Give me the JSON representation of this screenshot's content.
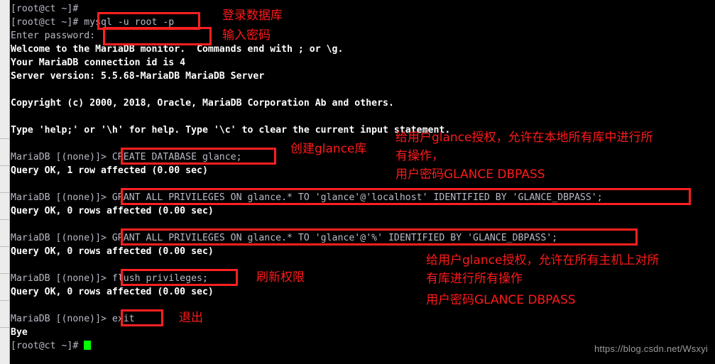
{
  "window": {
    "kind": "terminal",
    "background": "#000000",
    "text_color_dim": "#b9b9c6",
    "text_color_bold": "#ffffff",
    "annotation_color": "#ff1a1a",
    "cursor_color": "#00ff00",
    "gutter_color": "#ececec"
  },
  "terminal": {
    "lines": [
      {
        "id": "l01",
        "text": "[root@ct ~]#",
        "style": "dim"
      },
      {
        "id": "l02",
        "text": "[root@ct ~]# mysql -u root -p",
        "style": "dim"
      },
      {
        "id": "l03",
        "text": "Enter password:",
        "style": "dim"
      },
      {
        "id": "l04",
        "text": "Welcome to the MariaDB monitor.  Commands end with ; or \\g.",
        "style": "bold"
      },
      {
        "id": "l05",
        "text": "Your MariaDB connection id is 4",
        "style": "bold"
      },
      {
        "id": "l06",
        "text": "Server version: 5.5.68-MariaDB MariaDB Server",
        "style": "bold"
      },
      {
        "id": "l07",
        "text": "",
        "style": "bold"
      },
      {
        "id": "l08",
        "text": "Copyright (c) 2000, 2018, Oracle, MariaDB Corporation Ab and others.",
        "style": "bold"
      },
      {
        "id": "l09",
        "text": "",
        "style": "bold"
      },
      {
        "id": "l10",
        "text": "Type 'help;' or '\\h' for help. Type '\\c' to clear the current input statement.",
        "style": "bold"
      },
      {
        "id": "l11",
        "text": "",
        "style": "bold"
      },
      {
        "id": "l12",
        "text": "MariaDB [(none)]> CREATE DATABASE glance;",
        "style": "dim"
      },
      {
        "id": "l13",
        "text": "Query OK, 1 row affected (0.00 sec)",
        "style": "bold"
      },
      {
        "id": "l14",
        "text": "",
        "style": "bold"
      },
      {
        "id": "l15",
        "text": "MariaDB [(none)]> GRANT ALL PRIVILEGES ON glance.* TO 'glance'@'localhost' IDENTIFIED BY 'GLANCE_DBPASS';",
        "style": "dim"
      },
      {
        "id": "l16",
        "text": "Query OK, 0 rows affected (0.00 sec)",
        "style": "bold"
      },
      {
        "id": "l17",
        "text": "",
        "style": "bold"
      },
      {
        "id": "l18",
        "text": "MariaDB [(none)]> GRANT ALL PRIVILEGES ON glance.* TO 'glance'@'%' IDENTIFIED BY 'GLANCE_DBPASS';",
        "style": "dim"
      },
      {
        "id": "l19",
        "text": "Query OK, 0 rows affected (0.00 sec)",
        "style": "bold"
      },
      {
        "id": "l20",
        "text": "",
        "style": "bold"
      },
      {
        "id": "l21",
        "text": "MariaDB [(none)]> flush privileges;",
        "style": "dim"
      },
      {
        "id": "l22",
        "text": "Query OK, 0 rows affected (0.00 sec)",
        "style": "bold"
      },
      {
        "id": "l23",
        "text": "",
        "style": "bold"
      },
      {
        "id": "l24",
        "text": "MariaDB [(none)]> exit",
        "style": "dim"
      },
      {
        "id": "l25",
        "text": "Bye",
        "style": "bold"
      },
      {
        "id": "l26",
        "text": "[root@ct ~]# ",
        "style": "dim",
        "cursor": true
      }
    ]
  },
  "highlights": [
    {
      "id": "h-mysql-login",
      "target": "mysql -u root -p"
    },
    {
      "id": "h-password-entry",
      "target": ""
    },
    {
      "id": "h-create-db",
      "target": "CREATE DATABASE glance;"
    },
    {
      "id": "h-grant-localhost",
      "target": "GRANT ALL PRIVILEGES ON glance.* TO 'glance'@'localhost' IDENTIFIED BY 'GLANCE_DBPASS';"
    },
    {
      "id": "h-grant-any-host",
      "target": "GRANT ALL PRIVILEGES ON glance.* TO 'glance'@'%' IDENTIFIED BY 'GLANCE_DBPASS';"
    },
    {
      "id": "h-flush",
      "target": "flush privileges;"
    },
    {
      "id": "h-exit",
      "target": "exit"
    }
  ],
  "annotations": {
    "login_db": "登录数据库",
    "enter_password": "输入密码",
    "create_glance_db": "创建glance库",
    "grant_local_line1": "给用户glance授权，允许在本地所有库中进行所",
    "grant_local_line2": "有操作，",
    "grant_local_line3": "用户密码GLANCE DBPASS",
    "grant_any_line1": "给用户glance授权，允许在所有主机上对所",
    "grant_any_line2": "有库进行所有操作",
    "grant_any_line3": "用户密码GLANCE DBPASS",
    "flush_privileges": "刷新权限",
    "exit": "退出"
  },
  "watermark": {
    "text": "https://blog.csdn.net/Wsxyi"
  }
}
